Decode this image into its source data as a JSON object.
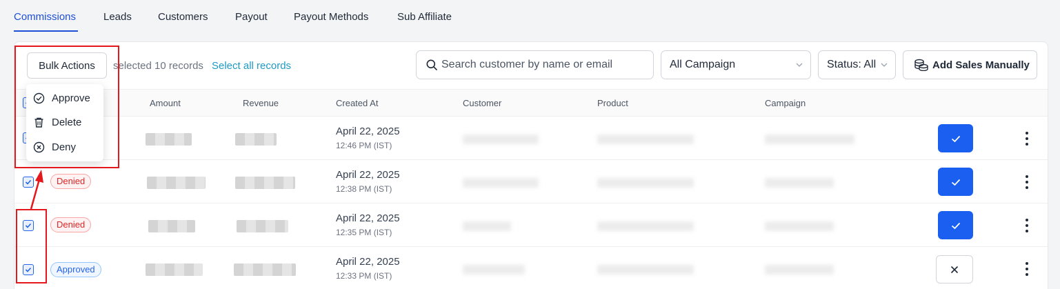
{
  "tabs": [
    {
      "label": "Commissions",
      "active": true
    },
    {
      "label": "Leads"
    },
    {
      "label": "Customers"
    },
    {
      "label": "Payout"
    },
    {
      "label": "Payout Methods"
    },
    {
      "label": "Sub Affiliate"
    }
  ],
  "toolbar": {
    "bulk_actions_label": "Bulk Actions",
    "selected_text": "selected 10 records",
    "select_all_label": "Select all records",
    "search_placeholder": "Search customer by name or email",
    "campaign_value": "All Campaign",
    "status_value": "Status: All",
    "add_sales_label": "Add Sales Manually"
  },
  "bulk_menu": [
    {
      "label": "Approve",
      "icon": "check-circle-icon"
    },
    {
      "label": "Delete",
      "icon": "trash-icon"
    },
    {
      "label": "Deny",
      "icon": "x-circle-icon"
    }
  ],
  "table": {
    "columns": [
      "Amount",
      "Revenue",
      "Created At",
      "Customer",
      "Product",
      "Campaign"
    ],
    "rows": [
      {
        "status": "",
        "date": "April 22, 2025",
        "time": "12:46 PM (IST)",
        "action": "approve"
      },
      {
        "status": "Denied",
        "date": "April 22, 2025",
        "time": "12:38 PM (IST)",
        "action": "approve"
      },
      {
        "status": "Denied",
        "date": "April 22, 2025",
        "time": "12:35 PM (IST)",
        "action": "approve"
      },
      {
        "status": "Approved",
        "date": "April 22, 2025",
        "time": "12:33 PM (IST)",
        "action": "deny"
      }
    ]
  },
  "colors": {
    "accent": "#1d4ed8",
    "primary_button": "#1a5ff0",
    "link": "#1e9ac4",
    "denied": "#dc2626",
    "approved": "#2563eb",
    "annotation": "#e3171c"
  }
}
